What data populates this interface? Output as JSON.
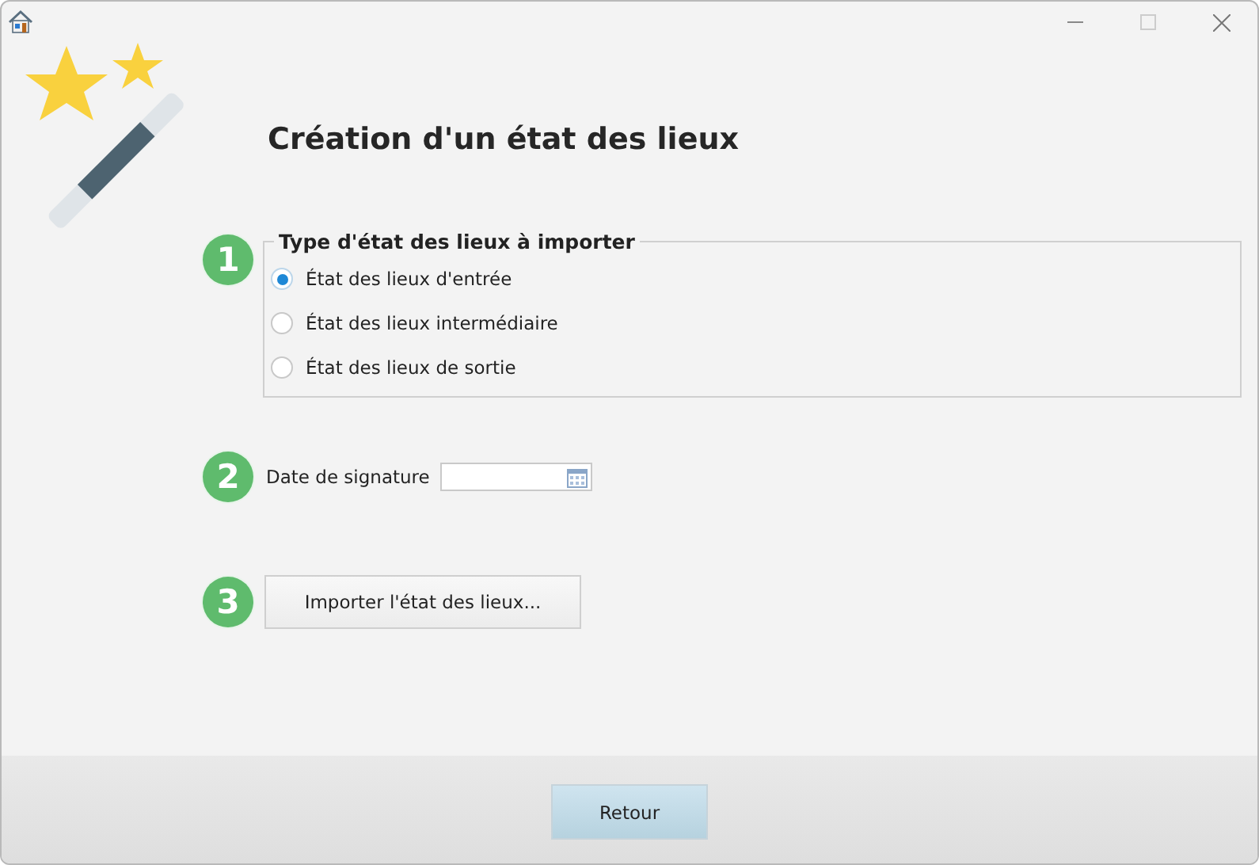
{
  "title": "Création d'un état des lieux",
  "step1": {
    "number": "1",
    "legend": "Type d'état des lieux à importer",
    "options": [
      {
        "label": "État des lieux d'entrée",
        "selected": true
      },
      {
        "label": "État des lieux intermédiaire",
        "selected": false
      },
      {
        "label": "État des lieux de sortie",
        "selected": false
      }
    ]
  },
  "step2": {
    "number": "2",
    "label": "Date de signature"
  },
  "step3": {
    "number": "3",
    "button": "Importer l'état des lieux..."
  },
  "footer": {
    "button": "Retour"
  }
}
